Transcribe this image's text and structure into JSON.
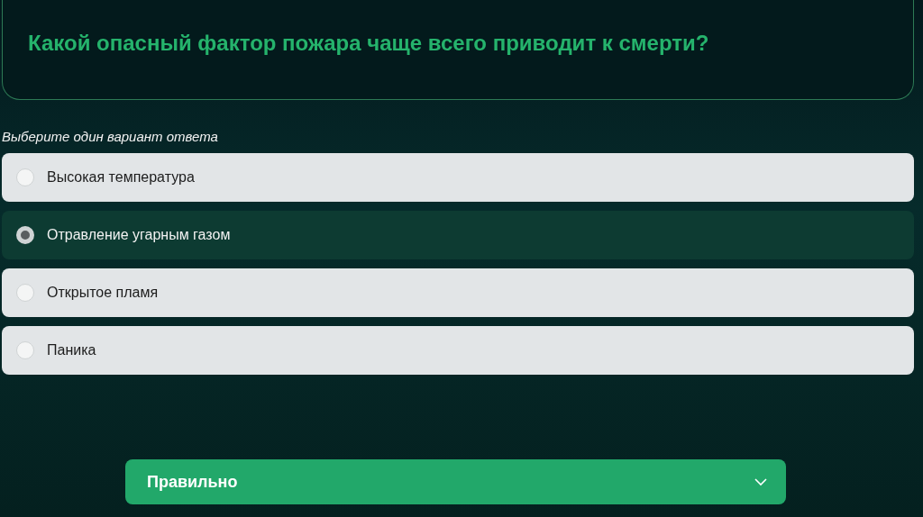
{
  "question": "Какой опасный фактор пожара чаще всего приводит к смерти?",
  "instruction": "Выберите один вариант ответа",
  "options": [
    {
      "label": "Высокая температура",
      "selected": false
    },
    {
      "label": "Отравление угарным газом",
      "selected": true
    },
    {
      "label": "Открытое пламя",
      "selected": false
    },
    {
      "label": "Паника",
      "selected": false
    }
  ],
  "result": {
    "label": "Правильно",
    "expanded": false
  }
}
